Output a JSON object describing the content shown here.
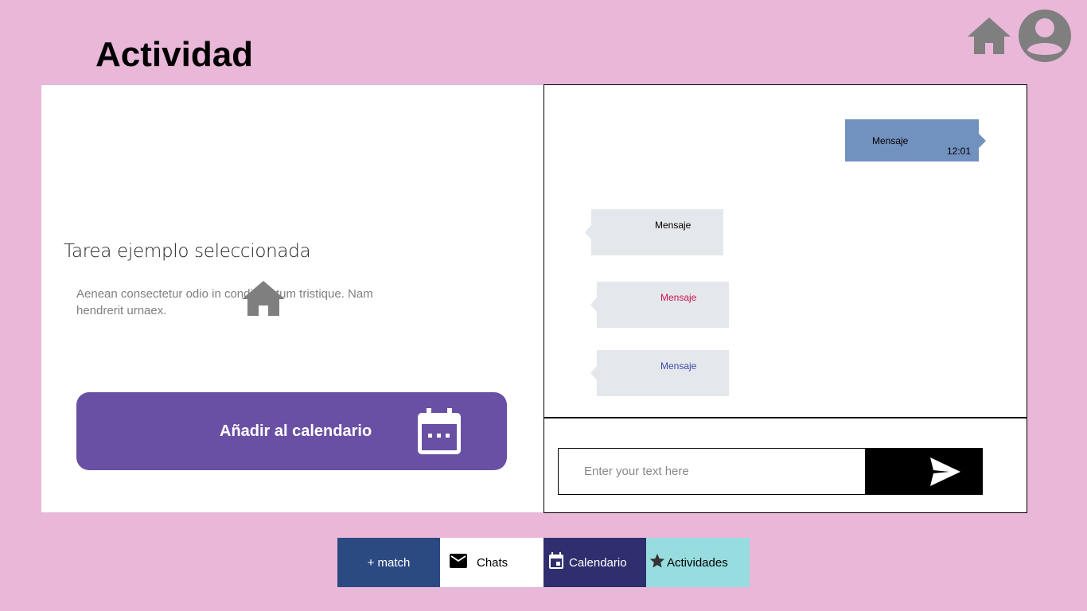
{
  "page": {
    "title": "Actividad"
  },
  "task": {
    "title": "Tarea ejemplo seleccionada",
    "description": "Aenean consectetur odio in condimentum tristique. Nam hendrerit urnaex.",
    "add_button_label": "Añadir al calendario"
  },
  "chat": {
    "outgoing": {
      "text": "Mensaje",
      "time": "12:01"
    },
    "incoming": [
      {
        "text": "Mensaje"
      },
      {
        "text": "Mensaje"
      },
      {
        "text": "Mensaje"
      }
    ],
    "input_placeholder": "Enter your text here"
  },
  "nav": {
    "match": "+ match",
    "chats": "Chats",
    "calendar": "Calendario",
    "activities": "Actividades"
  },
  "icons": [
    "home-icon",
    "user-avatar-icon",
    "calendar-icon",
    "send-icon",
    "mail-icon",
    "star-icon"
  ],
  "colors": {
    "background": "#e9b7d8",
    "accent_button": "#6a50a4",
    "outgoing_bubble": "#7191be",
    "incoming_bubble": "#e4e7eb",
    "nav_match": "#2c4a82",
    "nav_calendar": "#2f2e6e",
    "nav_activities": "#97dde0"
  }
}
